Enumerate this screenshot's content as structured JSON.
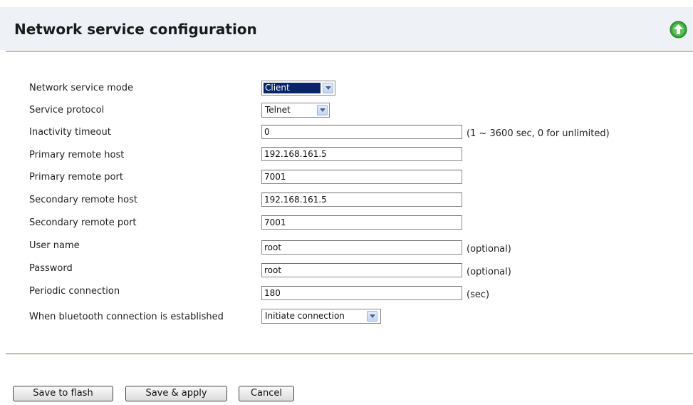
{
  "header": {
    "title": "Network service configuration",
    "top_button_icon": "arrow-up-circle-icon"
  },
  "form": {
    "mode": {
      "label": "Network service mode",
      "value": "Client"
    },
    "protocol": {
      "label": "Service protocol",
      "value": "Telnet"
    },
    "inactivity": {
      "label": "Inactivity timeout",
      "value": "0",
      "hint": "(1 ~ 3600 sec, 0 for unlimited)"
    },
    "primary_host": {
      "label": "Primary remote host",
      "value": "192.168.161.5"
    },
    "primary_port": {
      "label": "Primary remote port",
      "value": "7001"
    },
    "secondary_host": {
      "label": "Secondary remote host",
      "value": "192.168.161.5"
    },
    "secondary_port": {
      "label": "Secondary remote port",
      "value": "7001"
    },
    "user_name": {
      "label": "User name",
      "value": "root",
      "hint": "(optional)"
    },
    "password": {
      "label": "Password",
      "value": "root",
      "hint": "(optional)"
    },
    "periodic": {
      "label": "Periodic connection",
      "value": "180",
      "hint": "(sec)"
    },
    "bt_action": {
      "label": "When bluetooth connection is established",
      "value": "Initiate connection"
    }
  },
  "buttons": {
    "save_flash": "Save to flash",
    "save_apply": "Save & apply",
    "cancel": "Cancel"
  },
  "colors": {
    "header_bg": "#eef1f5",
    "divider": "#c4beb8",
    "selected_bg": "#0a246a",
    "top_icon": "#3aa23a"
  }
}
